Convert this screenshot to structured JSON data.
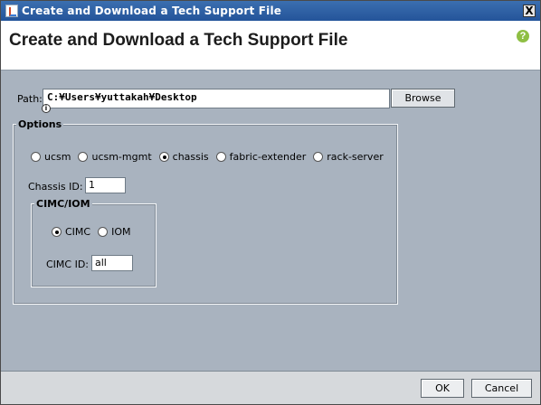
{
  "window": {
    "title": "Create and Download a Tech Support File",
    "close_glyph": "X"
  },
  "header": {
    "title": "Create and Download a Tech Support File",
    "help_glyph": "?",
    "help_icon": "help-icon"
  },
  "path": {
    "label": "Path:",
    "value": "C:¥Users¥yuttakah¥Desktop",
    "browse_label": "Browse",
    "info_glyph": "i"
  },
  "options": {
    "legend": "Options",
    "radios": [
      {
        "label": "ucsm",
        "selected": false
      },
      {
        "label": "ucsm-mgmt",
        "selected": false
      },
      {
        "label": "chassis",
        "selected": true
      },
      {
        "label": "fabric-extender",
        "selected": false
      },
      {
        "label": "rack-server",
        "selected": false
      }
    ],
    "chassis_id_label": "Chassis ID:",
    "chassis_id_value": "1"
  },
  "cimc": {
    "legend": "CIMC/IOM",
    "radios": [
      {
        "label": "CIMC",
        "selected": true
      },
      {
        "label": "IOM",
        "selected": false
      }
    ],
    "cimc_id_label": "CIMC ID:",
    "cimc_id_value": "all"
  },
  "footer": {
    "ok_label": "OK",
    "cancel_label": "Cancel"
  }
}
